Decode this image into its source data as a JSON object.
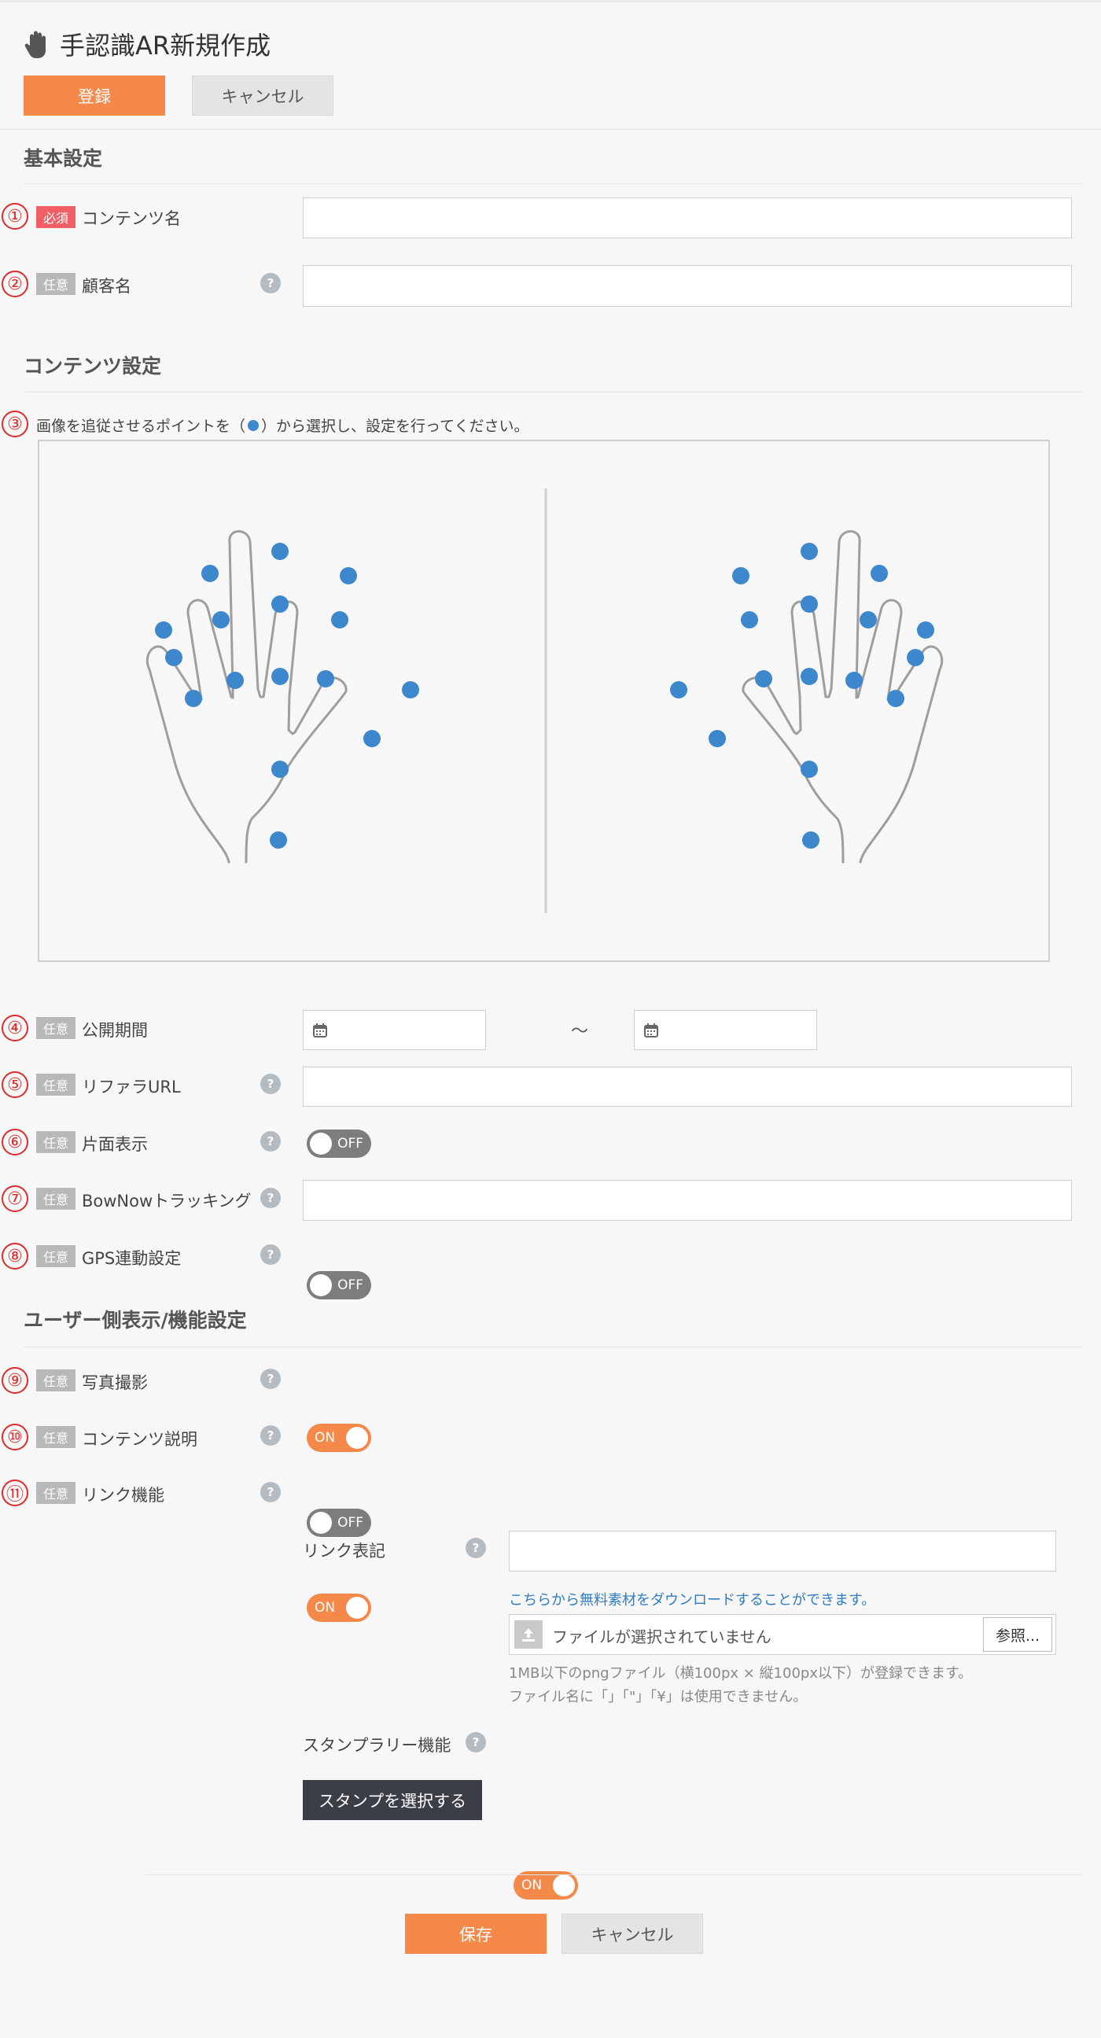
{
  "page": {
    "title": "手認識AR新規作成",
    "title_icon": "hand-icon",
    "register_button": "登録",
    "cancel_button": "キャンセル"
  },
  "basic": {
    "section_title": "基本設定",
    "content_name": {
      "num": "①",
      "badge": "必須",
      "label": "コンテンツ名",
      "value": ""
    },
    "customer_name": {
      "num": "②",
      "badge": "任意",
      "label": "顧客名",
      "value": ""
    }
  },
  "content_settings": {
    "section_title": "コンテンツ設定",
    "instruction_num": "③",
    "instruction_before": "画像を追従させるポイントを（",
    "instruction_after": "）から選択し、設定を行ってください。",
    "publish_period": {
      "num": "④",
      "badge": "任意",
      "label": "公開期間",
      "tilde": "～",
      "start": "",
      "end": ""
    },
    "referrer_url": {
      "num": "⑤",
      "badge": "任意",
      "label": "リファラURL",
      "value": ""
    },
    "single_side": {
      "num": "⑥",
      "badge": "任意",
      "label": "片面表示",
      "state": "OFF"
    },
    "bownow": {
      "num": "⑦",
      "badge": "任意",
      "label": "BowNowトラッキング",
      "value": ""
    },
    "gps": {
      "num": "⑧",
      "badge": "任意",
      "label": "GPS連動設定",
      "state": "OFF"
    }
  },
  "user_settings": {
    "section_title": "ユーザー側表示/機能設定",
    "photo": {
      "num": "⑨",
      "badge": "任意",
      "label": "写真撮影",
      "state": "ON"
    },
    "description": {
      "num": "⑩",
      "badge": "任意",
      "label": "コンテンツ説明",
      "state": "OFF"
    },
    "link": {
      "num": "⑪",
      "badge": "任意",
      "label": "リンク機能",
      "state": "ON"
    },
    "link_text": {
      "label": "リンク表記",
      "value": ""
    },
    "download_link": "こちらから無料素材をダウンロードすることができます。",
    "file": {
      "placeholder": "ファイルが選択されていません",
      "browse": "参照..."
    },
    "file_hint1": "1MB以下のpngファイル（横100px × 縦100px以下）が登録できます。",
    "file_hint2": "ファイル名に「」「\"」「¥」は使用できません。",
    "stamp_rally": {
      "label": "スタンプラリー機能",
      "state": "ON"
    },
    "stamp_select_button": "スタンプを選択する"
  },
  "footer": {
    "save_button": "保存",
    "cancel_button": "キャンセル"
  },
  "help_glyph": "?",
  "colors": {
    "accent": "#f4894a",
    "point": "#3d87cc",
    "required": "#ef6066",
    "number": "#e02b2b"
  }
}
